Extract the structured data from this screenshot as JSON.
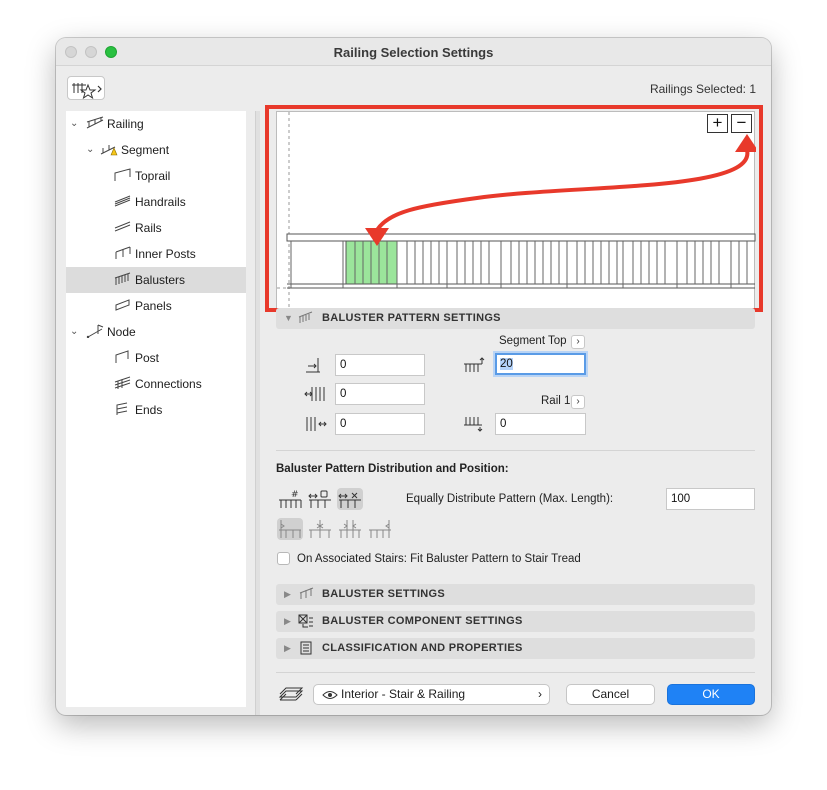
{
  "window": {
    "title": "Railing Selection Settings"
  },
  "header": {
    "selected_count": "Railings Selected: 1",
    "favorites_icon": "favorites-star-icon"
  },
  "tree": {
    "items": [
      {
        "label": "Railing",
        "icon": "railing-icon"
      },
      {
        "label": "Segment",
        "icon": "segment-warning-icon"
      },
      {
        "label": "Toprail",
        "icon": "toprail-icon"
      },
      {
        "label": "Handrails",
        "icon": "handrails-icon"
      },
      {
        "label": "Rails",
        "icon": "rails-icon"
      },
      {
        "label": "Inner Posts",
        "icon": "inner-posts-icon"
      },
      {
        "label": "Balusters",
        "icon": "balusters-icon"
      },
      {
        "label": "Panels",
        "icon": "panels-icon"
      },
      {
        "label": "Node",
        "icon": "node-icon"
      },
      {
        "label": "Post",
        "icon": "post-icon"
      },
      {
        "label": "Connections",
        "icon": "connections-icon"
      },
      {
        "label": "Ends",
        "icon": "ends-icon"
      }
    ],
    "selected": "Balusters"
  },
  "preview": {
    "zoom_in": "+",
    "zoom_out": "−"
  },
  "pattern_section": {
    "title": "BALUSTER PATTERN SETTINGS",
    "segment_top_label": "Segment Top",
    "rail_label": "Rail 1",
    "fields": {
      "offset_start": "0",
      "spacing": "0",
      "offset_end": "0",
      "segment_top": "20",
      "rail_bottom": "0"
    }
  },
  "distribution": {
    "title": "Baluster Pattern Distribution and Position:",
    "mode_label": "Equally Distribute Pattern (Max. Length):",
    "max_length": "100",
    "stairs_checkbox_label": "On Associated Stairs: Fit Baluster Pattern to Stair Tread"
  },
  "sections": [
    {
      "label": "BALUSTER SETTINGS",
      "icon": "baluster-settings-icon"
    },
    {
      "label": "BALUSTER COMPONENT SETTINGS",
      "icon": "component-settings-icon"
    },
    {
      "label": "CLASSIFICATION AND PROPERTIES",
      "icon": "classification-icon"
    }
  ],
  "footer": {
    "layer_value": "Interior - Stair & Railing",
    "cancel_label": "Cancel",
    "ok_label": "OK"
  },
  "colors": {
    "accent": "#1f82f5",
    "highlight_red": "#e8392b",
    "baluster_green": "#9be59b"
  }
}
